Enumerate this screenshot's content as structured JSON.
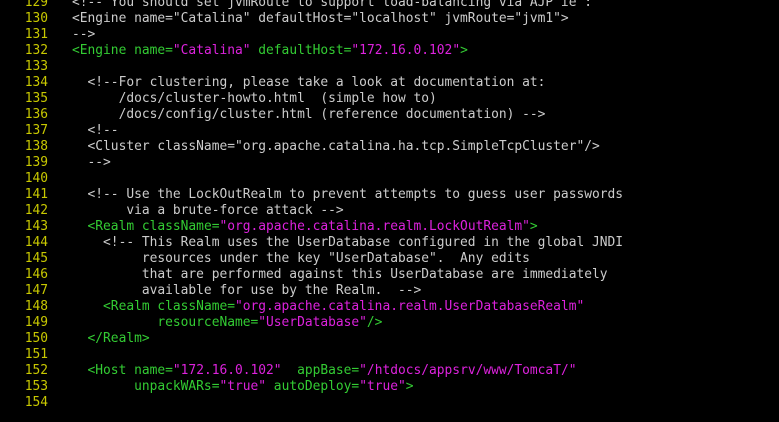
{
  "editor": {
    "lines": [
      {
        "n": "129",
        "t": [
          {
            "k": "comment",
            "s": "<!-- You should set jvmRoute to support load-balancing via AJP ie :"
          }
        ]
      },
      {
        "n": "130",
        "t": [
          {
            "k": "comment",
            "s": "<Engine name=\"Catalina\" defaultHost=\"localhost\" jvmRoute=\"jvm1\">"
          }
        ]
      },
      {
        "n": "131",
        "t": [
          {
            "k": "comment",
            "s": "-->"
          }
        ]
      },
      {
        "n": "132",
        "t": [
          {
            "k": "tag",
            "s": "<Engine "
          },
          {
            "k": "tag",
            "s": "name="
          },
          {
            "k": "str",
            "s": "\"Catalina\""
          },
          {
            "k": "tag",
            "s": " defaultHost="
          },
          {
            "k": "str",
            "s": "\"172.16.0.102\""
          },
          {
            "k": "tag",
            "s": ">"
          }
        ]
      },
      {
        "n": "133",
        "t": []
      },
      {
        "n": "134",
        "t": [
          {
            "k": "comment",
            "s": "  <!--For clustering, please take a look at documentation at:"
          }
        ]
      },
      {
        "n": "135",
        "t": [
          {
            "k": "comment",
            "s": "      /docs/cluster-howto.html  (simple how to)"
          }
        ]
      },
      {
        "n": "136",
        "t": [
          {
            "k": "comment",
            "s": "      /docs/config/cluster.html (reference documentation) -->"
          }
        ]
      },
      {
        "n": "137",
        "t": [
          {
            "k": "comment",
            "s": "  <!--"
          }
        ]
      },
      {
        "n": "138",
        "t": [
          {
            "k": "comment",
            "s": "  <Cluster className=\"org.apache.catalina.ha.tcp.SimpleTcpCluster\"/>"
          }
        ]
      },
      {
        "n": "139",
        "t": [
          {
            "k": "comment",
            "s": "  -->"
          }
        ]
      },
      {
        "n": "140",
        "t": []
      },
      {
        "n": "141",
        "t": [
          {
            "k": "comment",
            "s": "  <!-- Use the LockOutRealm to prevent attempts to guess user passwords"
          }
        ]
      },
      {
        "n": "142",
        "t": [
          {
            "k": "comment",
            "s": "       via a brute-force attack -->"
          }
        ]
      },
      {
        "n": "143",
        "t": [
          {
            "k": "tag",
            "s": "  <Realm "
          },
          {
            "k": "tag",
            "s": "className="
          },
          {
            "k": "str",
            "s": "\"org.apache.catalina.realm.LockOutRealm\""
          },
          {
            "k": "tag",
            "s": ">"
          }
        ]
      },
      {
        "n": "144",
        "t": [
          {
            "k": "comment",
            "s": "    <!-- This Realm uses the UserDatabase configured in the global JNDI"
          }
        ]
      },
      {
        "n": "145",
        "t": [
          {
            "k": "comment",
            "s": "         resources under the key \"UserDatabase\".  Any edits"
          }
        ]
      },
      {
        "n": "146",
        "t": [
          {
            "k": "comment",
            "s": "         that are performed against this UserDatabase are immediately"
          }
        ]
      },
      {
        "n": "147",
        "t": [
          {
            "k": "comment",
            "s": "         available for use by the Realm.  -->"
          }
        ]
      },
      {
        "n": "148",
        "t": [
          {
            "k": "tag",
            "s": "    <Realm "
          },
          {
            "k": "tag",
            "s": "className="
          },
          {
            "k": "str",
            "s": "\"org.apache.catalina.realm.UserDatabaseRealm\""
          }
        ]
      },
      {
        "n": "149",
        "t": [
          {
            "k": "tag",
            "s": "           resourceName="
          },
          {
            "k": "str",
            "s": "\"UserDatabase\""
          },
          {
            "k": "tag",
            "s": "/>"
          }
        ]
      },
      {
        "n": "150",
        "t": [
          {
            "k": "tag",
            "s": "  </Realm>"
          }
        ]
      },
      {
        "n": "151",
        "t": []
      },
      {
        "n": "152",
        "t": [
          {
            "k": "tag",
            "s": "  <Host "
          },
          {
            "k": "tag",
            "s": "name="
          },
          {
            "k": "str",
            "s": "\"172.16.0.102\""
          },
          {
            "k": "tag",
            "s": "  appBase="
          },
          {
            "k": "str",
            "s": "\"/htdocs/appsrv/www/TomcaT/\""
          }
        ]
      },
      {
        "n": "153",
        "t": [
          {
            "k": "tag",
            "s": "        unpackWARs="
          },
          {
            "k": "str",
            "s": "\"true\""
          },
          {
            "k": "tag",
            "s": " autoDeploy="
          },
          {
            "k": "str",
            "s": "\"true\""
          },
          {
            "k": "tag",
            "s": ">"
          }
        ]
      },
      {
        "n": "154",
        "t": []
      }
    ]
  },
  "colors": {
    "background": "#000000",
    "line_number": "#c8c800",
    "comment": "#cccccc",
    "tag": "#33cc33",
    "string": "#dd22dd"
  }
}
